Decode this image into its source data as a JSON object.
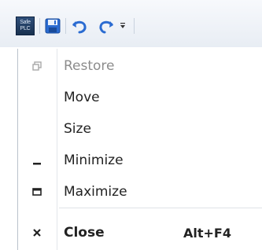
{
  "toolbar": {
    "app_logo_text_top": "Safe",
    "app_logo_text_bottom": "PLC",
    "items": [
      {
        "icon": "app-logo-icon"
      },
      {
        "icon": "save-icon"
      },
      {
        "icon": "undo-icon"
      },
      {
        "icon": "redo-icon"
      },
      {
        "icon": "customize-dropdown-icon"
      }
    ]
  },
  "menu": {
    "items": [
      {
        "label": "Restore",
        "icon": "restore-icon",
        "enabled": false
      },
      {
        "label": "Move",
        "icon": "",
        "enabled": true
      },
      {
        "label": "Size",
        "icon": "",
        "enabled": true
      },
      {
        "label": "Minimize",
        "icon": "minimize-icon",
        "enabled": true
      },
      {
        "label": "Maximize",
        "icon": "maximize-icon",
        "enabled": true
      },
      {
        "label": "Close",
        "icon": "close-icon",
        "enabled": true,
        "shortcut": "Alt+F4",
        "bold": true
      }
    ]
  },
  "colors": {
    "toolbar_icon_blue": "#2a6bd1",
    "menu_text": "#222222",
    "disabled_text": "#8c8c8c"
  }
}
